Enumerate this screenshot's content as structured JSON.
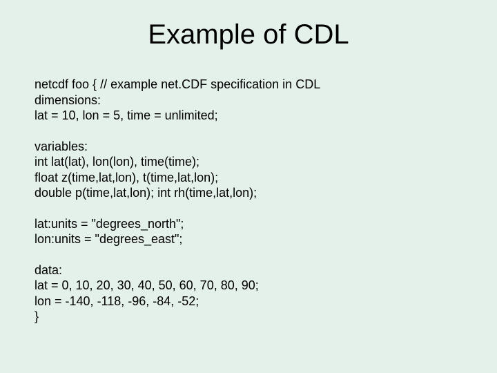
{
  "title": "Example of CDL",
  "blocks": {
    "b1": {
      "l1": "netcdf foo { // example net.CDF specification in CDL",
      "l2": "dimensions:",
      "l3": "lat = 10, lon = 5, time = unlimited;"
    },
    "b2": {
      "l1": "variables:",
      "l2": "int lat(lat), lon(lon), time(time);",
      "l3": "float z(time,lat,lon), t(time,lat,lon);",
      "l4": "double p(time,lat,lon); int rh(time,lat,lon);"
    },
    "b3": {
      "l1": "lat:units = \"degrees_north\";",
      "l2": "lon:units = \"degrees_east\";"
    },
    "b4": {
      "l1": "data:",
      "l2": "lat = 0, 10, 20, 30, 40, 50, 60, 70, 80, 90;",
      "l3": "lon = -140, -118, -96, -84, -52;",
      "l4": "}"
    }
  }
}
